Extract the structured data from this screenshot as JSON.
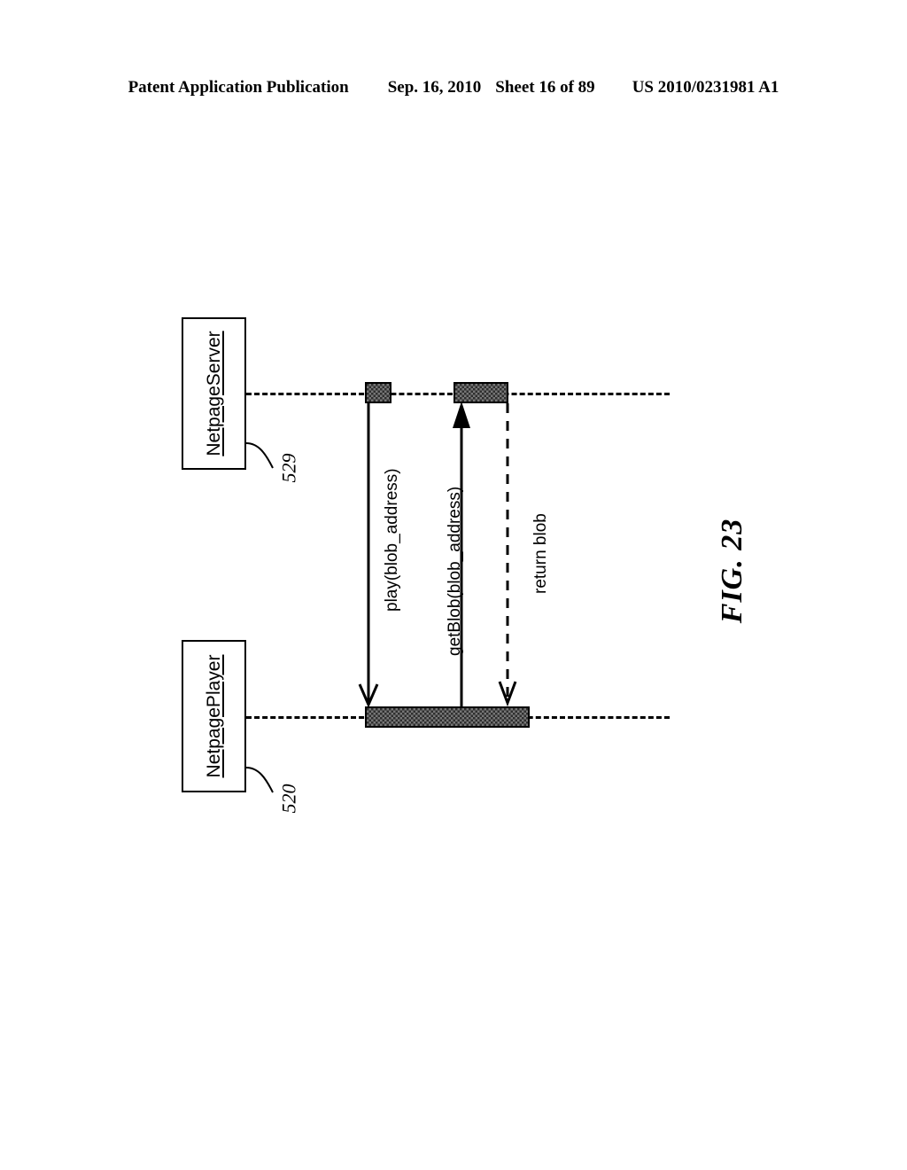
{
  "header": {
    "publication": "Patent Application Publication",
    "date": "Sep. 16, 2010",
    "sheet": "Sheet 16 of 89",
    "docnum": "US 2010/0231981 A1"
  },
  "figure": {
    "caption": "FIG. 23",
    "type": "uml-sequence-diagram",
    "orientation": "rotated-90-ccw"
  },
  "participants": [
    {
      "id": "netpage-server",
      "label": "NetpageServer",
      "ref": "529",
      "position": "top"
    },
    {
      "id": "netpage-player",
      "label": "NetpagePlayer",
      "ref": "520",
      "position": "bottom"
    }
  ],
  "messages": [
    {
      "id": "play",
      "label": "play(blob_address)",
      "from": "netpage-server",
      "to": "netpage-player",
      "arrow": "open",
      "line": "solid"
    },
    {
      "id": "get-blob",
      "label": "getBlob(blob_address)",
      "from": "netpage-player",
      "to": "netpage-server",
      "arrow": "filled",
      "line": "solid"
    },
    {
      "id": "return-blob",
      "label": "return blob",
      "from": "netpage-server",
      "to": "netpage-player",
      "arrow": "open",
      "line": "dashed"
    }
  ],
  "colors": {
    "ink": "#000000",
    "activation_fill": "#2e2e2e",
    "paper": "#ffffff"
  }
}
